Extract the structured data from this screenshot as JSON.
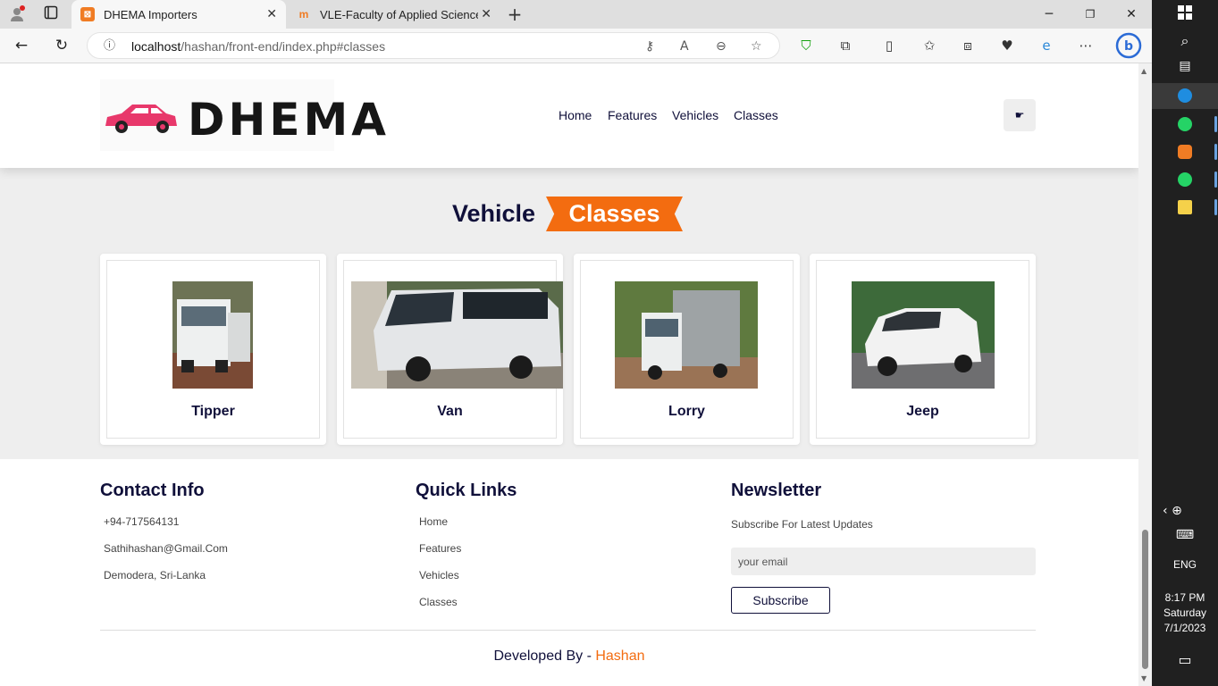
{
  "browser": {
    "tabs": [
      {
        "title": "DHEMA Importers",
        "active": true,
        "favicon": "xampp-icon"
      },
      {
        "title": "VLE-Faculty of Applied Science: L",
        "active": false,
        "favicon": "moodle-icon"
      }
    ],
    "url": {
      "host": "localhost",
      "path": "/hashan/front-end/index.php#classes"
    }
  },
  "site": {
    "logo_text": "DHEMA",
    "nav": [
      "Home",
      "Features",
      "Vehicles",
      "Classes"
    ],
    "section": {
      "title_a": "Vehicle",
      "title_b": "Classes"
    },
    "vehicles": [
      {
        "name": "Tipper"
      },
      {
        "name": "Van"
      },
      {
        "name": "Lorry"
      },
      {
        "name": "Jeep"
      }
    ],
    "footer": {
      "contact_title": "Contact Info",
      "contact": [
        "+94-717564131",
        "Sathihashan@Gmail.Com",
        "Demodera, Sri-Lanka"
      ],
      "links_title": "Quick Links",
      "links": [
        "Home",
        "Features",
        "Vehicles",
        "Classes"
      ],
      "newsletter_title": "Newsletter",
      "newsletter_text": "Subscribe For Latest Updates",
      "email_placeholder": "your email",
      "subscribe_label": "Subscribe",
      "credit_prefix": "Developed By - ",
      "credit_author": "Hashan"
    },
    "colors": {
      "accent": "#f36c10",
      "navy": "#10103a",
      "logo_pink": "#e8386b"
    }
  },
  "taskbar": {
    "language": "ENG",
    "time": "8:17 PM",
    "day": "Saturday",
    "date": "7/1/2023"
  }
}
